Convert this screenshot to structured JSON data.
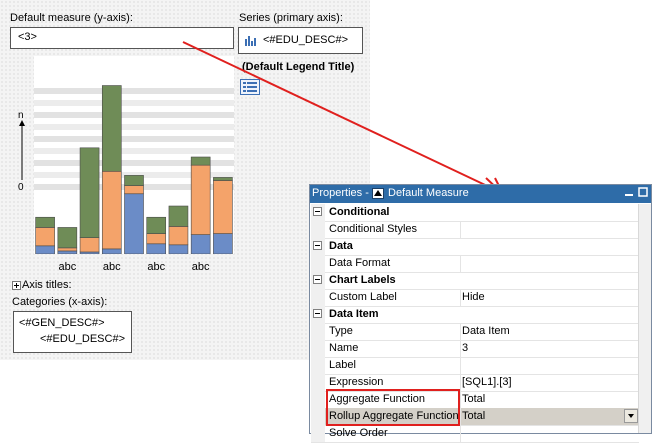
{
  "designer": {
    "measure_label": "Default measure (y-axis):",
    "measure_value": "<3>",
    "series_label": "Series (primary axis):",
    "series_value": "<#EDU_DESC#>",
    "legend_title": "(Default Legend Title)",
    "axis_n": "n",
    "axis_zero": "0",
    "axis_titles_label": "Axis titles:",
    "categories_label": "Categories (x-axis):",
    "category_items": [
      "<#GEN_DESC#>",
      "<#EDU_DESC#>"
    ]
  },
  "chart_data": {
    "type": "bar",
    "stacked": true,
    "categories": [
      "",
      "abc",
      "",
      "abc",
      "",
      "abc",
      "",
      "abc",
      ""
    ],
    "series": [
      {
        "values": [
          8,
          3,
          2,
          5,
          59,
          10,
          9,
          19,
          20
        ]
      },
      {
        "values": [
          18,
          3,
          14,
          76,
          8,
          10,
          18,
          68,
          52
        ]
      },
      {
        "values": [
          10,
          20,
          88,
          84,
          10,
          16,
          20,
          8,
          3
        ]
      }
    ],
    "colors": [
      "#6b8cc7",
      "#f4a36a",
      "#6f8c57"
    ],
    "ylim": [
      0,
      100
    ],
    "legend": false
  },
  "properties": {
    "title_prefix": "Properties -",
    "title_object": "Default Measure",
    "rows": [
      {
        "kind": "category",
        "key": "Conditional",
        "value": ""
      },
      {
        "kind": "prop",
        "key": "Conditional Styles",
        "value": ""
      },
      {
        "kind": "category",
        "key": "Data",
        "value": ""
      },
      {
        "kind": "prop",
        "key": "Data Format",
        "value": ""
      },
      {
        "kind": "category",
        "key": "Chart Labels",
        "value": ""
      },
      {
        "kind": "prop",
        "key": "Custom Label",
        "value": "Hide"
      },
      {
        "kind": "category",
        "key": "Data Item",
        "value": ""
      },
      {
        "kind": "prop",
        "key": "Type",
        "value": "Data Item"
      },
      {
        "kind": "prop",
        "key": "Name",
        "value": "3"
      },
      {
        "kind": "prop",
        "key": "Label",
        "value": ""
      },
      {
        "kind": "prop",
        "key": "Expression",
        "value": "[SQL1].[3]"
      },
      {
        "kind": "prop",
        "key": "Aggregate Function",
        "value": "Total"
      },
      {
        "kind": "prop",
        "key": "Rollup Aggregate Function",
        "value": "Total"
      },
      {
        "kind": "prop",
        "key": "Solve Order",
        "value": ""
      }
    ]
  },
  "colors": {
    "highlight": "#e0201e",
    "arrow": "#e0201e",
    "titlebar": "#2e6ca8"
  }
}
